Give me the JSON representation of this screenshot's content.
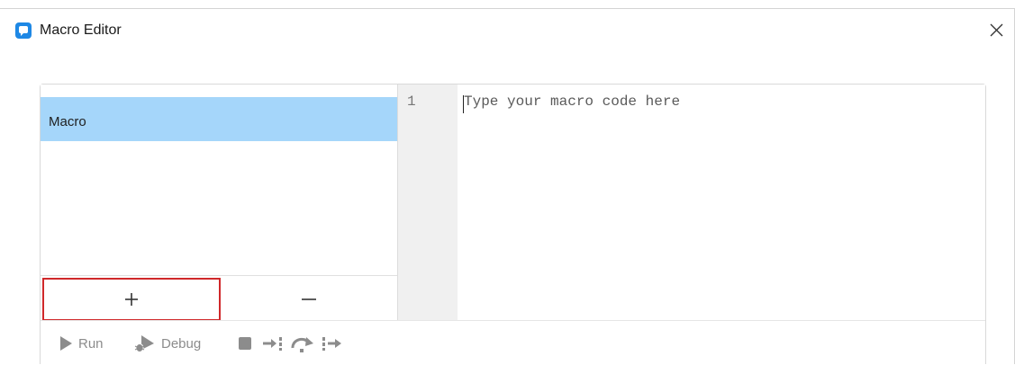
{
  "window": {
    "title": "Macro Editor",
    "icon": "app-chat-icon",
    "close_icon": "close-icon"
  },
  "macro_list": {
    "items": [
      {
        "label": "Macro",
        "selected": true
      }
    ],
    "add_button": {
      "symbol": "+",
      "icon": "plus-icon"
    },
    "remove_button": {
      "symbol": "−",
      "icon": "minus-icon"
    }
  },
  "editor": {
    "line_numbers": [
      "1"
    ],
    "placeholder": "Type your macro code here"
  },
  "toolbar": {
    "run_label": "Run",
    "debug_label": "Debug",
    "buttons": [
      {
        "name": "run",
        "icon": "play-icon"
      },
      {
        "name": "debug",
        "icon": "debug-bug-icon"
      },
      {
        "name": "stop",
        "icon": "stop-icon"
      },
      {
        "name": "step-into",
        "icon": "step-into-icon"
      },
      {
        "name": "step-over",
        "icon": "step-over-icon"
      },
      {
        "name": "step-out",
        "icon": "step-out-icon"
      }
    ]
  },
  "colors": {
    "selection": "#a5d6fa",
    "highlight_border": "#d0282a",
    "app_icon": "#1e88e5",
    "toolbar_icon": "#8c8c8c"
  }
}
